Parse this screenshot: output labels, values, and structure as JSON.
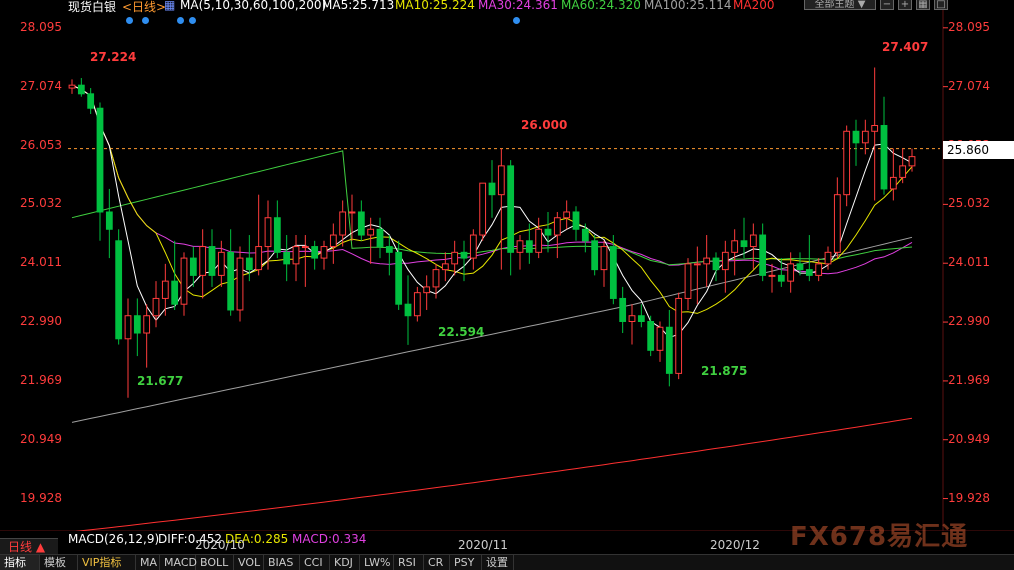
{
  "header": {
    "symbol": "现货白银",
    "period": "<日线>",
    "ma_label": "MA(5,10,30,60,100,200)",
    "ma5": "MA5:25.713",
    "ma10": "MA10:25.224",
    "ma30": "MA30:24.361",
    "ma60": "MA60:24.320",
    "ma100": "MA100:25.114",
    "ma200": "MA200",
    "theme_select": "全部主题"
  },
  "colors": {
    "up": "#ff3c3c",
    "down": "#00c040",
    "ma5": "#ffffff",
    "ma10": "#e6e600",
    "ma30": "#e040e0",
    "ma60": "#40d040",
    "ma100": "#a0a0a0",
    "ma200": "#ff3030"
  },
  "y_axis_labels": [
    "28.095",
    "27.074",
    "26.053",
    "25.032",
    "24.011",
    "22.990",
    "21.969",
    "20.949",
    "19.928"
  ],
  "current_price": "25.860",
  "annotations": {
    "high1": "27.224",
    "low1": "21.677",
    "low2": "22.594",
    "high2": "26.000",
    "low3": "21.875",
    "high3": "27.407"
  },
  "date_labels": [
    "2020/10",
    "2020/11",
    "2020/12"
  ],
  "macd": {
    "title": "MACD(26,12,9)",
    "diff": "DIFF:0.452",
    "dea": "DEA:0.285",
    "macd": "MACD:0.334"
  },
  "day_button": "日线 ▲",
  "tabs": [
    "指标",
    "模板",
    "VIP指标",
    "MA",
    "MACD",
    "BOLL",
    "VOL",
    "BIAS",
    "CCI",
    "KDJ",
    "LW%",
    "RSI",
    "CR",
    "PSY",
    "设置"
  ],
  "watermark": "FX678易汇通",
  "chart_data": {
    "type": "candlestick",
    "ylim": [
      19.4,
      28.3
    ],
    "y_ticks": [
      28.095,
      27.074,
      26.053,
      25.032,
      24.011,
      22.99,
      21.969,
      20.949,
      19.928
    ],
    "candles": [
      [
        27.05,
        27.2,
        26.95,
        27.1
      ],
      [
        27.1,
        27.224,
        26.9,
        26.95
      ],
      [
        26.95,
        27.05,
        26.6,
        26.7
      ],
      [
        26.7,
        26.8,
        24.4,
        24.9
      ],
      [
        24.9,
        25.3,
        24.1,
        24.6
      ],
      [
        24.4,
        24.6,
        22.6,
        22.7
      ],
      [
        22.7,
        23.4,
        21.677,
        23.1
      ],
      [
        23.1,
        23.4,
        22.4,
        22.8
      ],
      [
        22.8,
        23.3,
        22.2,
        23.1
      ],
      [
        23.1,
        23.7,
        22.9,
        23.4
      ],
      [
        23.4,
        24.0,
        23.1,
        23.7
      ],
      [
        23.7,
        24.4,
        23.2,
        23.3
      ],
      [
        23.3,
        24.2,
        23.1,
        24.1
      ],
      [
        24.1,
        24.3,
        23.6,
        23.8
      ],
      [
        23.8,
        24.6,
        23.4,
        24.3
      ],
      [
        24.3,
        24.6,
        23.6,
        23.8
      ],
      [
        23.8,
        24.4,
        23.6,
        24.2
      ],
      [
        24.2,
        24.6,
        23.1,
        23.2
      ],
      [
        23.2,
        24.3,
        23.0,
        24.1
      ],
      [
        24.1,
        24.5,
        23.7,
        23.9
      ],
      [
        23.9,
        25.2,
        23.8,
        24.3
      ],
      [
        24.3,
        25.1,
        23.9,
        24.8
      ],
      [
        24.8,
        25.1,
        24.1,
        24.2
      ],
      [
        24.2,
        24.5,
        23.7,
        24.0
      ],
      [
        24.0,
        24.5,
        23.7,
        24.3
      ],
      [
        24.3,
        24.5,
        23.6,
        24.3
      ],
      [
        24.3,
        24.4,
        23.9,
        24.1
      ],
      [
        24.1,
        24.4,
        23.9,
        24.3
      ],
      [
        24.3,
        24.7,
        24.0,
        24.5
      ],
      [
        24.5,
        25.1,
        24.3,
        24.9
      ],
      [
        24.9,
        25.2,
        24.4,
        24.9
      ],
      [
        24.9,
        25.1,
        24.4,
        24.5
      ],
      [
        24.5,
        24.8,
        24.0,
        24.6
      ],
      [
        24.6,
        24.8,
        24.1,
        24.3
      ],
      [
        24.3,
        24.5,
        23.8,
        24.2
      ],
      [
        24.2,
        24.4,
        23.2,
        23.3
      ],
      [
        23.3,
        23.8,
        22.594,
        23.1
      ],
      [
        23.1,
        23.6,
        23.0,
        23.5
      ],
      [
        23.5,
        23.8,
        23.2,
        23.6
      ],
      [
        23.6,
        24.0,
        23.4,
        23.9
      ],
      [
        23.9,
        24.2,
        23.7,
        24.0
      ],
      [
        24.0,
        24.4,
        23.8,
        24.2
      ],
      [
        24.2,
        24.4,
        23.7,
        24.1
      ],
      [
        24.1,
        24.6,
        23.9,
        24.5
      ],
      [
        24.5,
        25.4,
        24.4,
        25.4
      ],
      [
        25.4,
        25.8,
        24.8,
        25.2
      ],
      [
        25.2,
        26.0,
        23.9,
        25.7
      ],
      [
        25.7,
        25.8,
        23.8,
        24.2
      ],
      [
        24.2,
        24.5,
        23.9,
        24.4
      ],
      [
        24.4,
        24.7,
        24.0,
        24.2
      ],
      [
        24.2,
        24.8,
        24.1,
        24.6
      ],
      [
        24.6,
        24.9,
        24.2,
        24.5
      ],
      [
        24.5,
        24.9,
        24.1,
        24.8
      ],
      [
        24.8,
        25.1,
        24.6,
        24.9
      ],
      [
        24.9,
        25.0,
        24.4,
        24.6
      ],
      [
        24.6,
        24.7,
        24.2,
        24.4
      ],
      [
        24.4,
        24.5,
        23.8,
        23.9
      ],
      [
        23.9,
        24.4,
        23.6,
        24.3
      ],
      [
        24.3,
        24.5,
        23.3,
        23.4
      ],
      [
        23.4,
        23.6,
        22.8,
        23.0
      ],
      [
        23.0,
        23.3,
        22.6,
        23.1
      ],
      [
        23.1,
        23.3,
        22.9,
        23.0
      ],
      [
        23.0,
        23.1,
        22.4,
        22.5
      ],
      [
        22.5,
        23.0,
        22.3,
        22.9
      ],
      [
        22.9,
        23.2,
        21.875,
        22.1
      ],
      [
        22.1,
        23.5,
        22.0,
        23.4
      ],
      [
        23.4,
        24.1,
        23.2,
        24.0
      ],
      [
        24.0,
        24.3,
        23.3,
        24.0
      ],
      [
        24.0,
        24.5,
        23.6,
        24.1
      ],
      [
        24.1,
        24.2,
        23.7,
        23.9
      ],
      [
        23.9,
        24.4,
        23.5,
        24.2
      ],
      [
        24.2,
        24.6,
        23.8,
        24.4
      ],
      [
        24.4,
        24.8,
        24.1,
        24.3
      ],
      [
        24.3,
        24.7,
        23.9,
        24.5
      ],
      [
        24.5,
        24.7,
        23.7,
        23.8
      ],
      [
        23.8,
        24.0,
        23.5,
        23.8
      ],
      [
        23.8,
        24.1,
        23.6,
        23.7
      ],
      [
        23.7,
        24.2,
        23.5,
        24.0
      ],
      [
        24.0,
        24.2,
        23.8,
        23.9
      ],
      [
        23.9,
        24.5,
        23.7,
        23.8
      ],
      [
        23.8,
        24.1,
        23.7,
        24.0
      ],
      [
        24.0,
        24.3,
        23.9,
        24.2
      ],
      [
        24.2,
        25.5,
        24.1,
        25.2
      ],
      [
        25.2,
        26.4,
        25.0,
        26.3
      ],
      [
        26.3,
        26.5,
        25.7,
        26.1
      ],
      [
        26.1,
        26.5,
        25.9,
        26.3
      ],
      [
        26.3,
        27.407,
        25.1,
        26.4
      ],
      [
        26.4,
        26.9,
        25.2,
        25.3
      ],
      [
        25.3,
        26.0,
        25.1,
        25.5
      ],
      [
        25.5,
        26.0,
        25.4,
        25.7
      ],
      [
        25.7,
        26.0,
        25.6,
        25.86
      ]
    ]
  }
}
